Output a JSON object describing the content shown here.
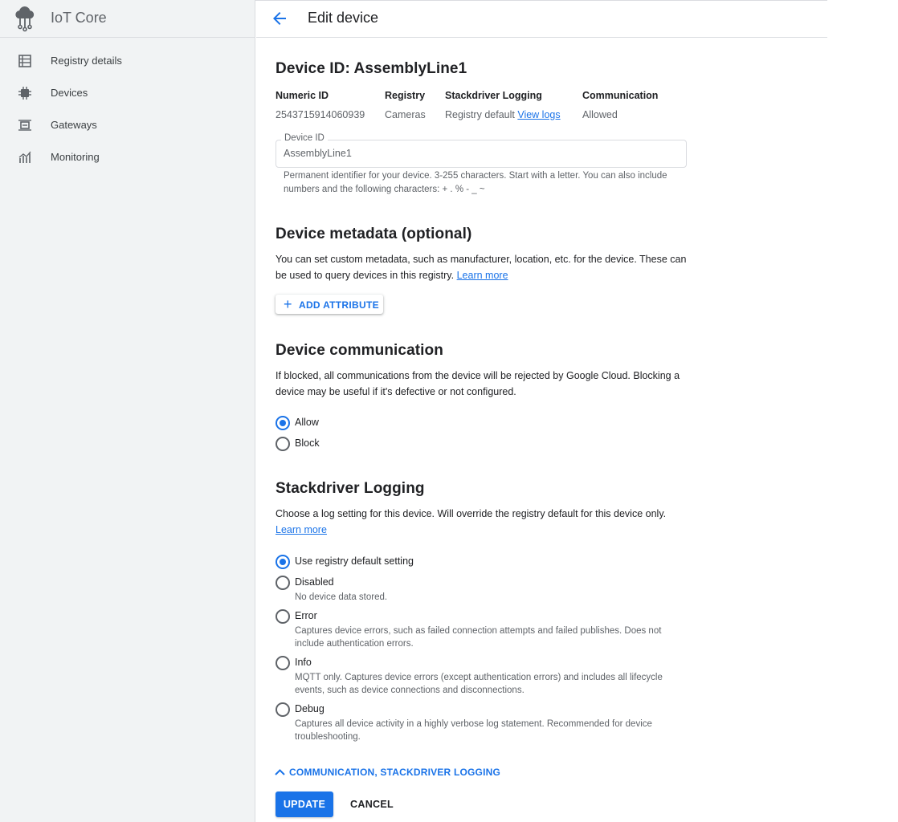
{
  "app": {
    "title": "IoT Core"
  },
  "sidebar": {
    "items": [
      {
        "label": "Registry details",
        "icon": "list-icon"
      },
      {
        "label": "Devices",
        "icon": "chip-icon"
      },
      {
        "label": "Gateways",
        "icon": "gateway-icon"
      },
      {
        "label": "Monitoring",
        "icon": "chart-icon"
      }
    ]
  },
  "header": {
    "title": "Edit device"
  },
  "device": {
    "heading": "Device ID: AssemblyLine1",
    "meta": {
      "numeric_id_label": "Numeric ID",
      "numeric_id": "2543715914060939",
      "registry_label": "Registry",
      "registry": "Cameras",
      "logging_label": "Stackdriver Logging",
      "logging": "Registry default",
      "view_logs": "View logs",
      "communication_label": "Communication",
      "communication": "Allowed"
    },
    "id_field": {
      "label": "Device ID",
      "value": "AssemblyLine1",
      "hint": "Permanent identifier for your device. 3-255 characters. Start with a letter. You can also include numbers and the following characters: + . % - _ ~"
    }
  },
  "metadata": {
    "heading": "Device metadata (optional)",
    "description": "You can set custom metadata, such as manufacturer, location, etc. for the device. These can be used to query devices in this registry.",
    "learn_more": "Learn more",
    "add_attribute": "ADD ATTRIBUTE"
  },
  "communication": {
    "heading": "Device communication",
    "description": "If blocked, all communications from the device will be rejected by Google Cloud. Blocking a device may be useful if it's defective or not configured.",
    "options": [
      {
        "label": "Allow",
        "checked": true
      },
      {
        "label": "Block",
        "checked": false
      }
    ]
  },
  "logging": {
    "heading": "Stackdriver Logging",
    "description": "Choose a log setting for this device. Will override the registry default for this device only.",
    "learn_more": "Learn more",
    "options": [
      {
        "label": "Use registry default setting",
        "desc": "",
        "checked": true
      },
      {
        "label": "Disabled",
        "desc": "No device data stored.",
        "checked": false
      },
      {
        "label": "Error",
        "desc": "Captures device errors, such as failed connection attempts and failed publishes. Does not include authentication errors.",
        "checked": false
      },
      {
        "label": "Info",
        "desc": "MQTT only. Captures device errors (except authentication errors) and includes all lifecycle events, such as device connections and disconnections.",
        "checked": false
      },
      {
        "label": "Debug",
        "desc": "Captures all device activity in a highly verbose log statement. Recommended for device troubleshooting.",
        "checked": false
      }
    ]
  },
  "footer": {
    "collapse_label": "COMMUNICATION, STACKDRIVER LOGGING",
    "update": "UPDATE",
    "cancel": "CANCEL"
  },
  "colors": {
    "accent": "#1a73e8",
    "sidebar_bg": "#f1f3f4",
    "border": "#dadce0"
  }
}
